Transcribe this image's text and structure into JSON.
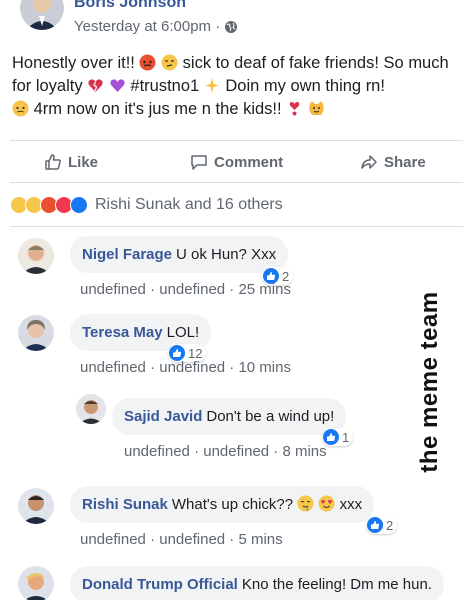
{
  "post": {
    "author": "Boris Johnson",
    "timestamp": "Yesterday at 6:00pm ·",
    "line1": "Honestly over it!!",
    "line1b": "sick to deaf of fake friends! So",
    "line2a": "much for loyalty",
    "line2b": "#trustno1",
    "line2c": "Doin my own thing rn!",
    "line3": "4rm now on it's jus me n the kids!!"
  },
  "actions": {
    "like": "Like",
    "comment": "Comment",
    "share": "Share"
  },
  "reactions": {
    "label": "Rishi Sunak and 16 others"
  },
  "comments": [
    {
      "name": "Nigel Farage",
      "text": "U ok Hun? Xxx",
      "meta": "undefined · undefined · 25 mins",
      "likes": "2"
    },
    {
      "name": "Teresa May",
      "text": "LOL!",
      "meta": "undefined · undefined · 10 mins",
      "likes": "12"
    },
    {
      "name": "Sajid Javid",
      "text": "Don't be a wind up!",
      "meta": "undefined · undefined · 8 mins",
      "likes": "1"
    },
    {
      "name": "Rishi Sunak",
      "text": "What's up chick??",
      "text2": "xxx",
      "meta": "undefined · undefined · 5 mins",
      "likes": "2"
    },
    {
      "name": "Donald Trump Official",
      "text": "Kno the feeling! Dm me hun."
    }
  ],
  "watermark": "the meme team",
  "colors": {
    "link": "#385898",
    "muted": "#606770",
    "bubble": "#f2f3f5",
    "like_blue": "#1877f2"
  }
}
